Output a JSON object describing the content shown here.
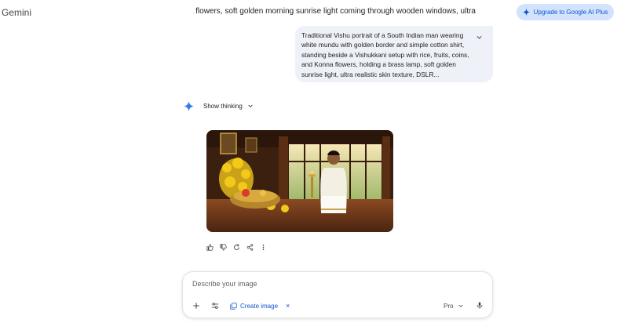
{
  "header": {
    "app_title": "Gemini",
    "conversation_title": "nna flowers, soft golden morning sunrise light coming through wooden windows, ultra",
    "upgrade_label": "Upgrade to Google AI Plus"
  },
  "prompt": {
    "text": "Traditional Vishu portrait of a South Indian man wearing white mundu with golden border and simple cotton shirt, standing beside a Vishukkani setup with rice, fruits, coins, and Konna flowers, holding a brass lamp, soft golden sunrise light, ultra realistic skin texture, DSLR..."
  },
  "response": {
    "thinking_label": "Show thinking"
  },
  "composer": {
    "placeholder": "Describe your image",
    "create_image_label": "Create image",
    "chip_close": "×",
    "model_label": "Pro"
  },
  "colors": {
    "accent": "#0b57d0",
    "upgrade_bg": "#d3e3fd",
    "bubble_bg": "#eef1f8"
  }
}
